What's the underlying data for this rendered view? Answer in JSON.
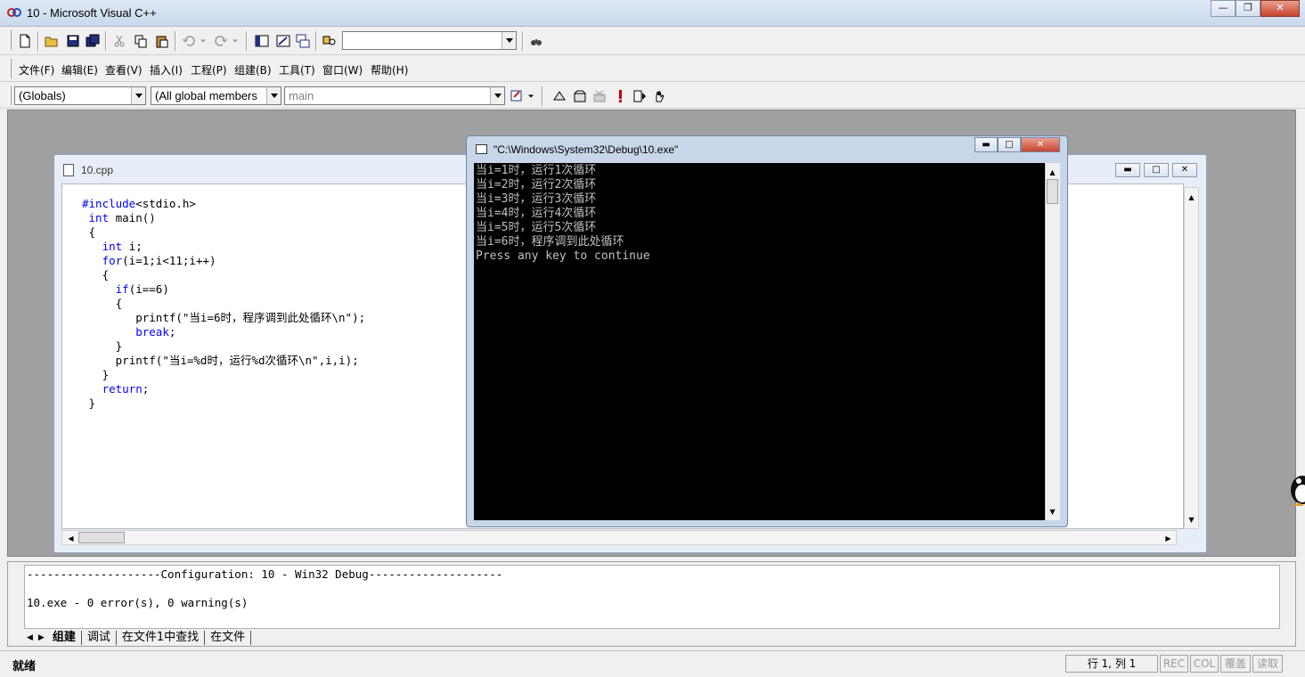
{
  "window": {
    "title": "10 - Microsoft Visual C++"
  },
  "menu": [
    {
      "label": "文件(F)"
    },
    {
      "label": "编辑(E)"
    },
    {
      "label": "查看(V)"
    },
    {
      "label": "插入(I)"
    },
    {
      "label": "工程(P)"
    },
    {
      "label": "组建(B)"
    },
    {
      "label": "工具(T)"
    },
    {
      "label": "窗口(W)"
    },
    {
      "label": "帮助(H)"
    }
  ],
  "toolbar": {
    "find_combo_value": "",
    "scope_combo": "(Globals)",
    "members_combo": "(All global members",
    "function_combo": "main"
  },
  "editor": {
    "file_tab": "10.cpp",
    "code_lines": [
      {
        "kw": "#include",
        "rest": "<stdio.h>"
      },
      {
        "kw": "int",
        "rest": " main()",
        "indent": " "
      },
      {
        "kw": "",
        "rest": "{",
        "indent": " "
      },
      {
        "kw": "int",
        "rest": " i;",
        "indent": "   "
      },
      {
        "kw": "for",
        "rest": "(i=1;i<11;i++)",
        "indent": "   "
      },
      {
        "kw": "",
        "rest": "{",
        "indent": "   "
      },
      {
        "kw": "if",
        "rest": "(i==6)",
        "indent": "     "
      },
      {
        "kw": "",
        "rest": "{",
        "indent": "     "
      },
      {
        "kw": "",
        "rest": "printf(\"当i=6时，程序调到此处循环\\n\");",
        "indent": "        "
      },
      {
        "kw": "break",
        "rest": ";",
        "indent": "        "
      },
      {
        "kw": "",
        "rest": "}",
        "indent": "     "
      },
      {
        "kw": "",
        "rest": "printf(\"当i=%d时，运行%d次循环\\n\",i,i);",
        "indent": "     "
      },
      {
        "kw": "",
        "rest": "}",
        "indent": "   "
      },
      {
        "kw": "return",
        "rest": ";",
        "indent": "   "
      },
      {
        "kw": "",
        "rest": "}",
        "indent": " "
      }
    ]
  },
  "console": {
    "title": "\"C:\\Windows\\System32\\Debug\\10.exe\"",
    "lines": [
      "当i=1时，运行1次循环",
      "当i=2时，运行2次循环",
      "当i=3时，运行3次循环",
      "当i=4时，运行4次循环",
      "当i=5时，运行5次循环",
      "当i=6时，程序调到此处循环",
      "Press any key to continue"
    ]
  },
  "output": {
    "lines": [
      "--------------------Configuration: 10 - Win32 Debug--------------------",
      "",
      "10.exe - 0 error(s), 0 warning(s)"
    ],
    "tabs": [
      {
        "label": "组建"
      },
      {
        "label": "调试"
      },
      {
        "label": "在文件1中查找"
      },
      {
        "label": "在文件"
      }
    ]
  },
  "status": {
    "text": "就绪",
    "position": "行 1, 列 1",
    "rec": "REC",
    "col": "COL",
    "ovr": "覆盖",
    "read": "读取"
  },
  "colors": {
    "keyword": "#0000ff",
    "console_bg": "#000000",
    "console_fg": "#c0c0c0"
  }
}
